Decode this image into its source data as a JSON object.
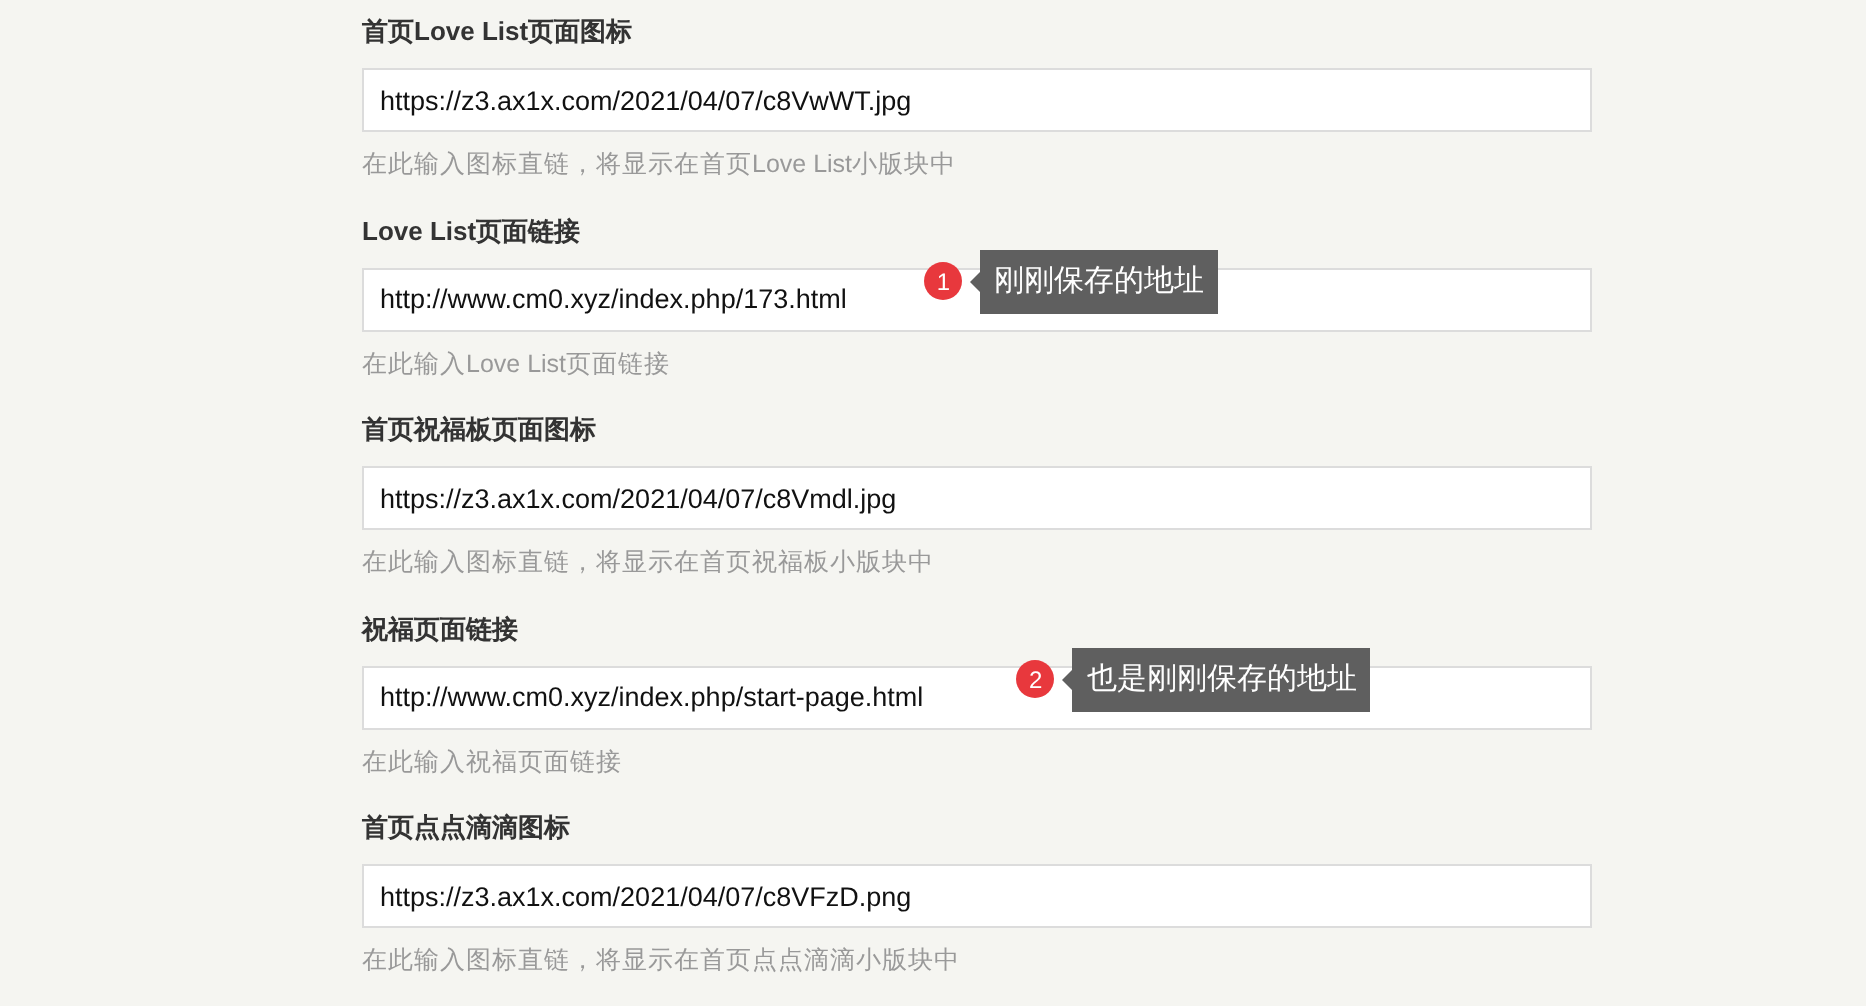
{
  "fields": [
    {
      "label": "首页Love List页面图标",
      "value": "https://z3.ax1x.com/2021/04/07/c8VwWT.jpg",
      "hint": "在此输入图标直链，将显示在首页Love List小版块中"
    },
    {
      "label": "Love List页面链接",
      "value": "http://www.cm0.xyz/index.php/173.html",
      "hint": "在此输入Love List页面链接",
      "annotation": {
        "number": "1",
        "text": "刚刚保存的地址"
      }
    },
    {
      "label": "首页祝福板页面图标",
      "value": "https://z3.ax1x.com/2021/04/07/c8Vmdl.jpg",
      "hint": "在此输入图标直链，将显示在首页祝福板小版块中"
    },
    {
      "label": "祝福页面链接",
      "value": "http://www.cm0.xyz/index.php/start-page.html",
      "hint": "在此输入祝福页面链接",
      "annotation": {
        "number": "2",
        "text": "也是刚刚保存的地址"
      }
    },
    {
      "label": "首页点点滴滴图标",
      "value": "https://z3.ax1x.com/2021/04/07/c8VFzD.png",
      "hint": "在此输入图标直链，将显示在首页点点滴滴小版块中"
    }
  ]
}
